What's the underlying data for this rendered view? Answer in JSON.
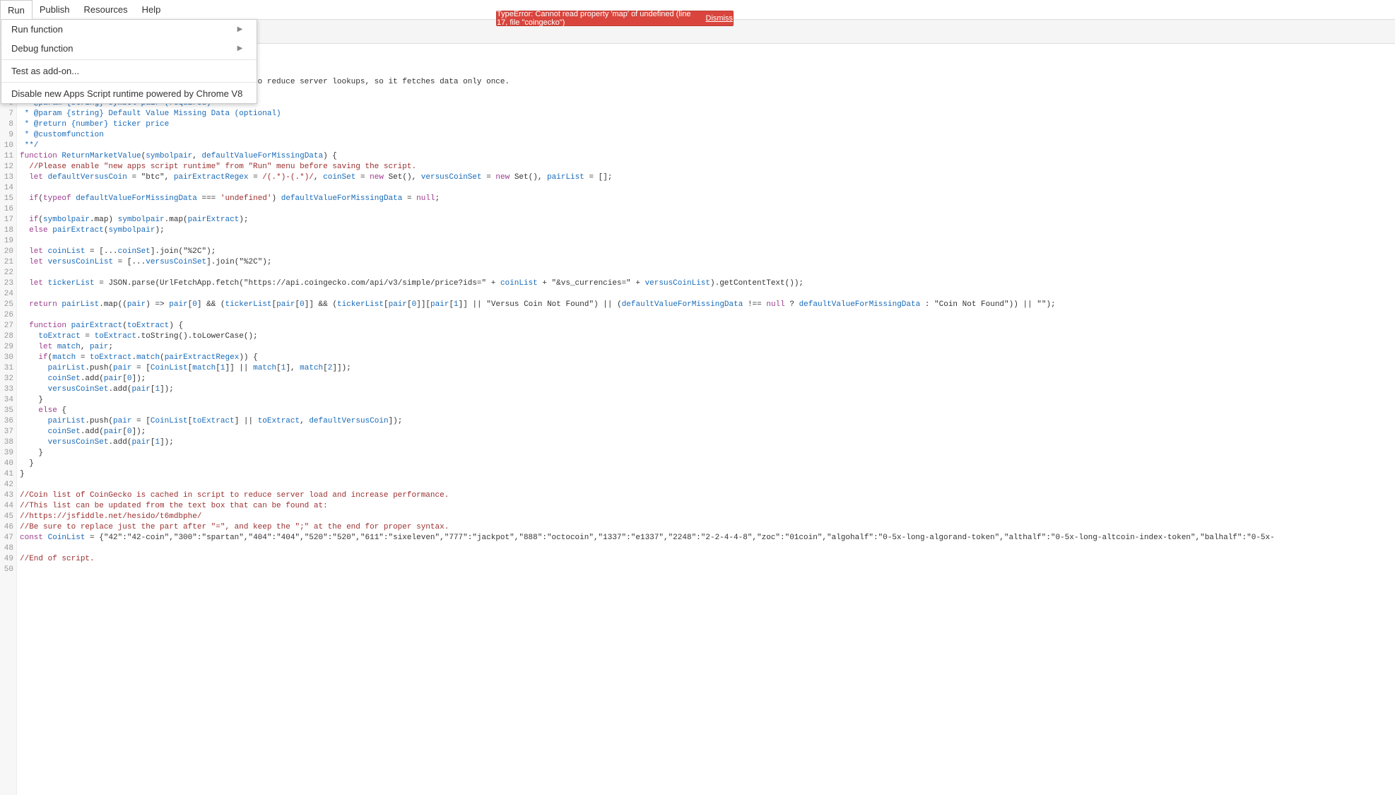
{
  "menubar": {
    "items": [
      "Run",
      "Publish",
      "Resources",
      "Help"
    ]
  },
  "dropdown": {
    "items": [
      {
        "label": "Run function",
        "submenu": true
      },
      {
        "label": "Debug function",
        "submenu": true
      }
    ],
    "items2": [
      {
        "label": "Test as add-on...",
        "submenu": false
      }
    ],
    "items3": [
      {
        "label": "Disable new Apps Script runtime powered by Chrome V8",
        "submenu": false
      }
    ]
  },
  "error": {
    "message": "TypeError: Cannot read property 'map' of undefined (line 17, file \"coingecko\")",
    "dismiss": "Dismiss"
  },
  "code": {
    "lines": [
      "",
      "",
      "",
      "                                               it to reduce server lookups, so it fetches data only once.",
      " *",
      " * @param {string} symbol pair (required)",
      " * @param {string} Default Value Missing Data (optional)",
      " * @return {number} ticker price",
      " * @customfunction",
      " **/",
      "function ReturnMarketValue(symbolpair, defaultValueForMissingData) {",
      "  //Please enable \"new apps script runtime\" from \"Run\" menu before saving the script.",
      "  let defaultVersusCoin = \"btc\", pairExtractRegex = /(.*)-(.*)/, coinSet = new Set(), versusCoinSet = new Set(), pairList = [];",
      "",
      "  if(typeof defaultValueForMissingData === 'undefined') defaultValueForMissingData = null;",
      "",
      "  if(symbolpair.map) symbolpair.map(pairExtract);",
      "  else pairExtract(symbolpair);",
      "",
      "  let coinList = [...coinSet].join(\"%2C\");",
      "  let versusCoinList = [...versusCoinSet].join(\"%2C\");",
      "",
      "  let tickerList = JSON.parse(UrlFetchApp.fetch(\"https://api.coingecko.com/api/v3/simple/price?ids=\" + coinList + \"&vs_currencies=\" + versusCoinList).getContentText());",
      "",
      "  return pairList.map((pair) => pair[0] && (tickerList[pair[0]] && (tickerList[pair[0]][pair[1]] || \"Versus Coin Not Found\") || (defaultValueForMissingData !== null ? defaultValueForMissingData : \"Coin Not Found\")) || \"\");",
      "",
      "  function pairExtract(toExtract) {",
      "    toExtract = toExtract.toString().toLowerCase();",
      "    let match, pair;",
      "    if(match = toExtract.match(pairExtractRegex)) {",
      "      pairList.push(pair = [CoinList[match[1]] || match[1], match[2]]);",
      "      coinSet.add(pair[0]);",
      "      versusCoinSet.add(pair[1]);",
      "    }",
      "    else {",
      "      pairList.push(pair = [CoinList[toExtract] || toExtract, defaultVersusCoin]);",
      "      coinSet.add(pair[0]);",
      "      versusCoinSet.add(pair[1]);",
      "    }",
      "  }",
      "}",
      "",
      "//Coin list of CoinGecko is cached in script to reduce server load and increase performance.",
      "//This list can be updated from the text box that can be found at:",
      "//https://jsfiddle.net/hesido/t6mdbphe/",
      "//Be sure to replace just the part after \"=\", and keep the \";\" at the end for proper syntax.",
      "const CoinList = {\"42\":\"42-coin\",\"300\":\"spartan\",\"404\":\"404\",\"520\":\"520\",\"611\":\"sixeleven\",\"777\":\"jackpot\",\"888\":\"octocoin\",\"1337\":\"e1337\",\"2248\":\"2-2-4-4-8\",\"zoc\":\"01coin\",\"algohalf\":\"0-5x-long-algorand-token\",\"althalf\":\"0-5x-long-altcoin-index-token\",\"balhalf\":\"0-5x-",
      "",
      "//End of script.",
      ""
    ]
  }
}
